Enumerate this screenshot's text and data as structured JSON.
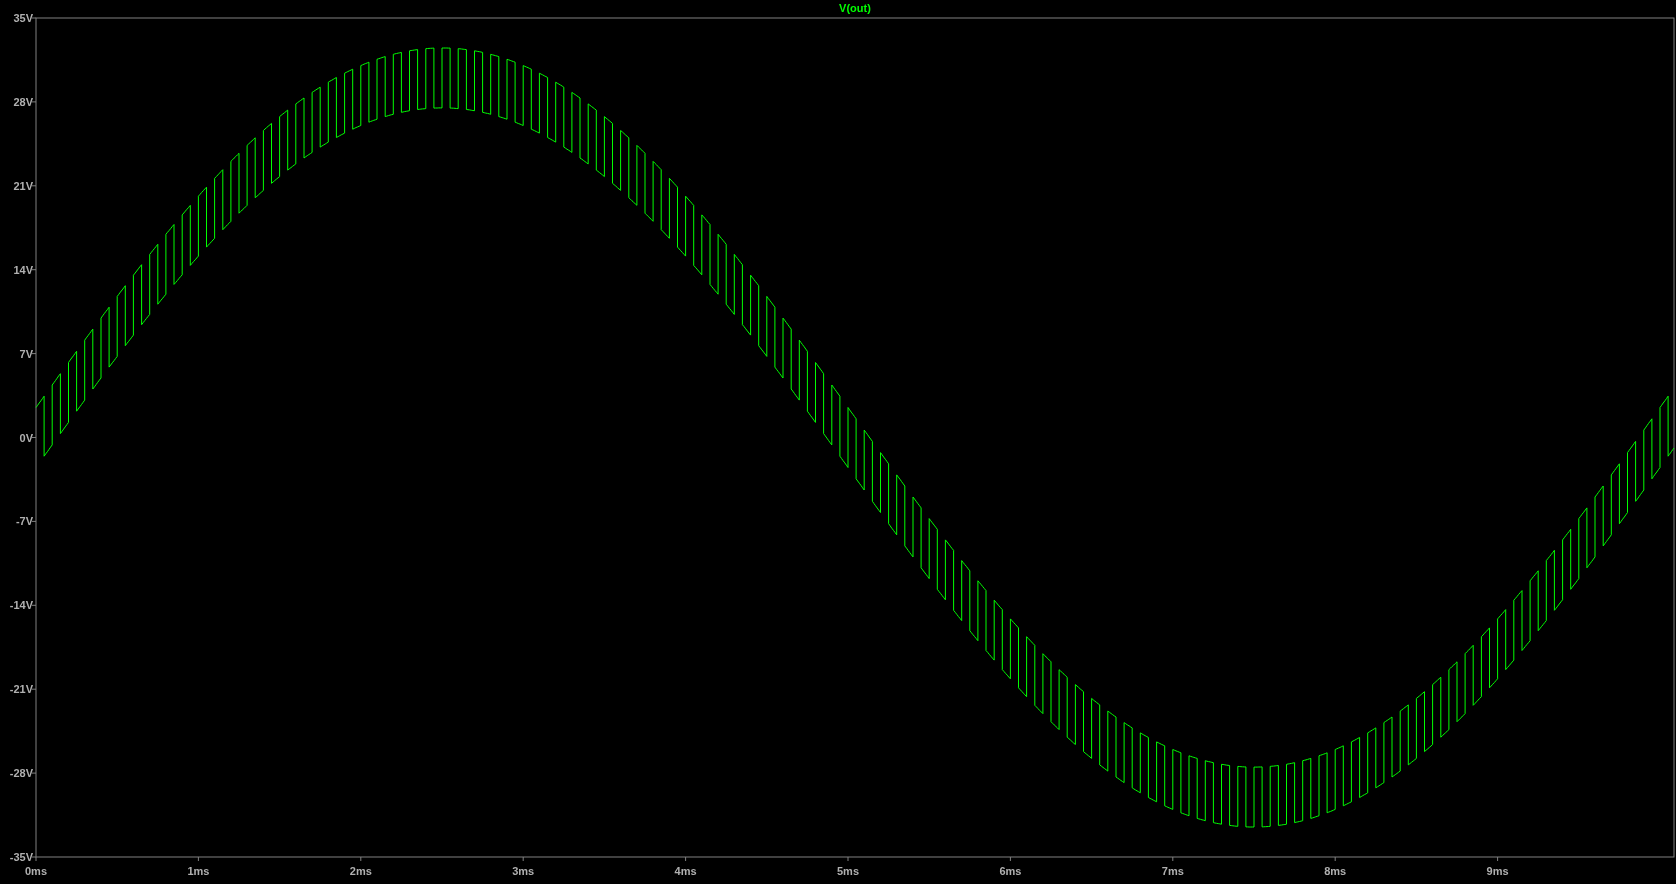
{
  "plot": {
    "title": "V(out)",
    "y_axis_labels": [
      "35V",
      "28V",
      "21V",
      "14V",
      "7V",
      "0V",
      "-7V",
      "-14V",
      "-21V",
      "-28V",
      "-35V"
    ],
    "x_axis_labels": [
      "0ms",
      "1ms",
      "2ms",
      "3ms",
      "4ms",
      "5ms",
      "6ms",
      "7ms",
      "8ms",
      "9ms"
    ]
  }
}
